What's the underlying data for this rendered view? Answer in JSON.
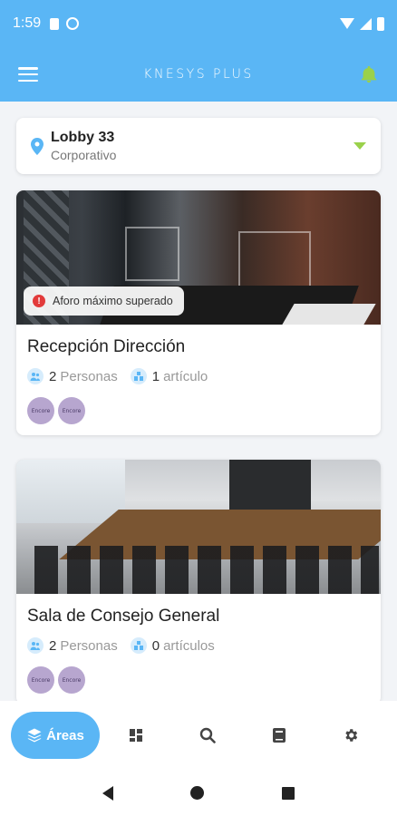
{
  "status_bar": {
    "time": "1:59"
  },
  "app_bar": {
    "title": "KNESYS PLUS"
  },
  "location": {
    "name": "Lobby 33",
    "type": "Corporativo"
  },
  "cards": [
    {
      "title": "Recepción Dirección",
      "alert": "Aforo máximo superado",
      "persons_count": "2",
      "persons_label": "Personas",
      "items_count": "1",
      "items_label": "artículo",
      "badges": [
        "Encore",
        "Encore"
      ]
    },
    {
      "title": "Sala de Consejo General",
      "persons_count": "2",
      "persons_label": "Personas",
      "items_count": "0",
      "items_label": "artículos",
      "badges": [
        "Encore",
        "Encore"
      ]
    }
  ],
  "bottom_nav": {
    "active_label": "Áreas",
    "items": [
      "dashboard-icon",
      "search-icon",
      "book-icon",
      "settings-icon"
    ]
  },
  "colors": {
    "primary": "#5ab6f5",
    "accent_green": "#9ad14b",
    "alert_red": "#e23b3b"
  }
}
